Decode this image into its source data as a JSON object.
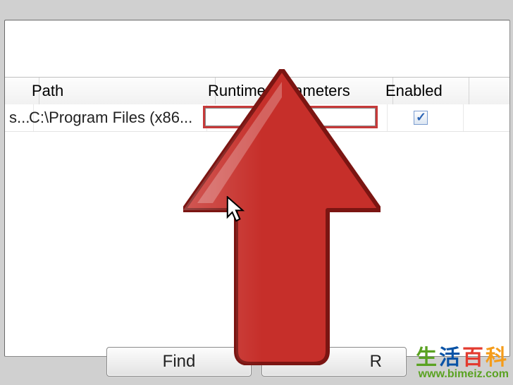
{
  "table": {
    "headers": {
      "col0": "",
      "path": "Path",
      "runtime": "Runtime Parameters",
      "enabled": "Enabled"
    },
    "row": {
      "col0": "s...",
      "path": "C:\\Program Files (x86...",
      "runtime": "",
      "enabled_checked": true
    }
  },
  "buttons": {
    "find": "Find",
    "second_visible": "R"
  },
  "watermark": {
    "text": "生活百科",
    "url": "www.bimeiz.com"
  }
}
